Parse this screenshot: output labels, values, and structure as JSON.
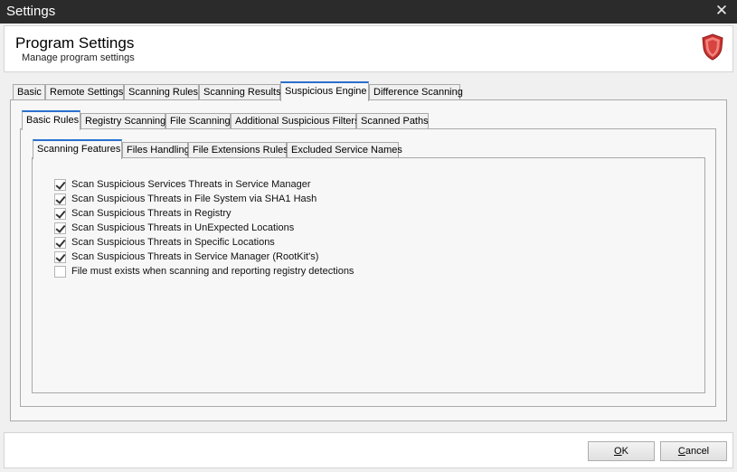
{
  "window": {
    "title": "Settings",
    "close_glyph": "✕"
  },
  "header": {
    "title": "Program Settings",
    "subtitle": "Manage program settings",
    "icon": "shield-icon",
    "accent": "#d83a36"
  },
  "main_tabs": [
    {
      "label": "Basic"
    },
    {
      "label": "Remote Settings"
    },
    {
      "label": "Scanning Rules"
    },
    {
      "label": "Scanning Results"
    },
    {
      "label": "Suspicious Engine",
      "active": true
    },
    {
      "label": "Difference Scanning"
    }
  ],
  "sub_tabs": [
    {
      "label": "Basic Rules",
      "active": true
    },
    {
      "label": "Registry Scanning"
    },
    {
      "label": "File Scanning"
    },
    {
      "label": "Additional Suspicious Filters"
    },
    {
      "label": "Scanned Paths"
    }
  ],
  "inner_tabs": [
    {
      "label": "Scanning Features",
      "active": true
    },
    {
      "label": "Files Handling"
    },
    {
      "label": "File Extensions Rules"
    },
    {
      "label": "Excluded Service Names"
    }
  ],
  "features": [
    {
      "label": "Scan Suspicious Services Threats in Service Manager",
      "checked": true
    },
    {
      "label": "Scan Suspicious Threats in File System via SHA1 Hash",
      "checked": true
    },
    {
      "label": "Scan Suspicious Threats in Registry",
      "checked": true
    },
    {
      "label": "Scan Suspicious Threats in UnExpected Locations",
      "checked": true
    },
    {
      "label": "Scan Suspicious Threats in Specific Locations",
      "checked": true
    },
    {
      "label": "Scan Suspicious Threats in Service Manager (RootKit's)",
      "checked": true
    },
    {
      "label": "File must exists when scanning and reporting registry detections",
      "checked": false
    }
  ],
  "footer": {
    "ok_mnemonic": "O",
    "ok_rest": "K",
    "cancel_mnemonic": "C",
    "cancel_rest": "ancel"
  },
  "colors": {
    "tab_accent": "#2a6fcf",
    "titlebar": "#2b2b2b"
  }
}
